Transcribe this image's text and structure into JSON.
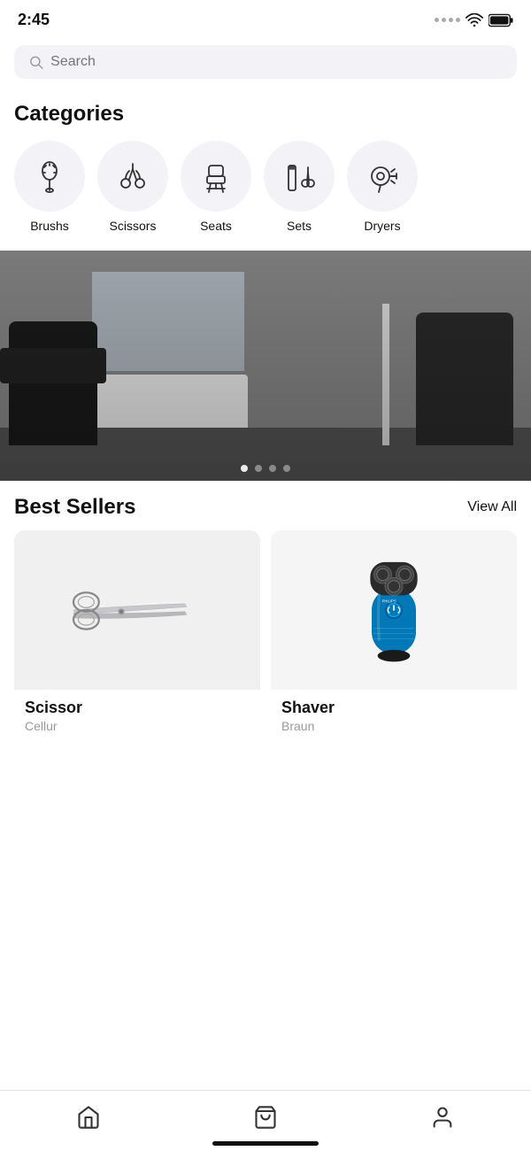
{
  "statusBar": {
    "time": "2:45",
    "wifiLabel": "wifi",
    "batteryLabel": "battery"
  },
  "search": {
    "placeholder": "Search"
  },
  "categories": {
    "title": "Categories",
    "items": [
      {
        "id": "brushes",
        "label": "Brushs",
        "icon": "brush"
      },
      {
        "id": "scissors",
        "label": "Scissors",
        "icon": "scissors"
      },
      {
        "id": "seats",
        "label": "Seats",
        "icon": "seat"
      },
      {
        "id": "sets",
        "label": "Sets",
        "icon": "sets"
      },
      {
        "id": "dryers",
        "label": "Dryers",
        "icon": "dryer"
      }
    ]
  },
  "banner": {
    "dots": [
      true,
      false,
      false,
      false
    ]
  },
  "bestSellers": {
    "title": "Best Sellers",
    "viewAll": "View All",
    "products": [
      {
        "id": "scissor",
        "name": "Scissor",
        "brand": "Cellur"
      },
      {
        "id": "shaver",
        "name": "Shaver",
        "brand": "Braun"
      }
    ]
  },
  "bottomNav": {
    "items": [
      {
        "id": "home",
        "icon": "home"
      },
      {
        "id": "cart",
        "icon": "cart"
      },
      {
        "id": "profile",
        "icon": "profile"
      }
    ]
  }
}
